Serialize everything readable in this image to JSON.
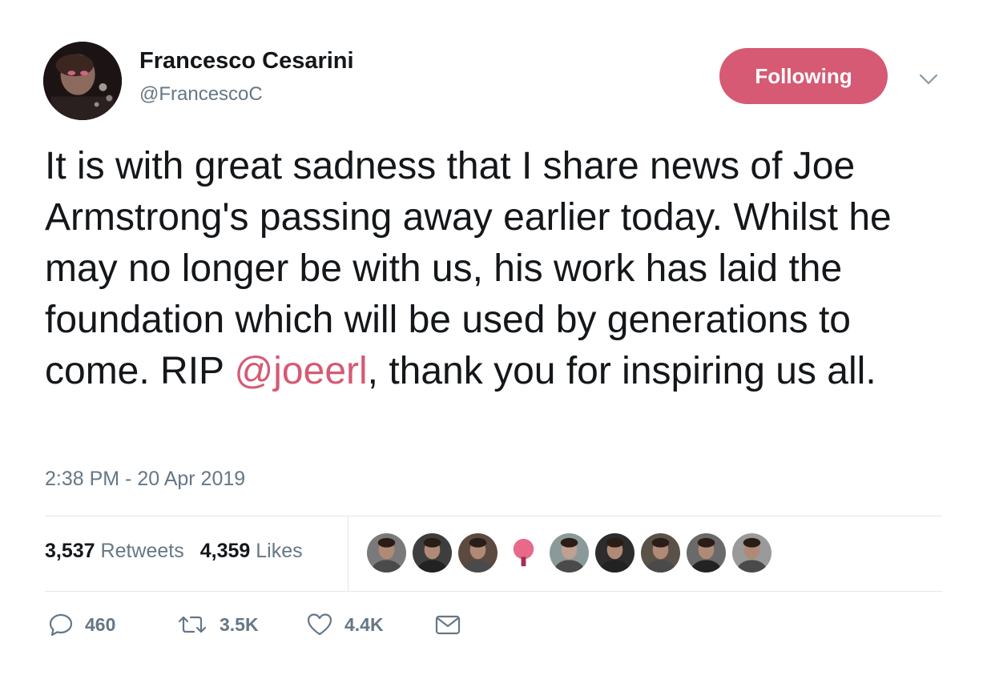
{
  "author": {
    "display_name": "Francesco Cesarini",
    "handle": "@FrancescoC",
    "avatar_icon": "user-photo"
  },
  "follow_button": {
    "label": "Following",
    "color": "#d65a74"
  },
  "caret_icon": "chevron-down-icon",
  "tweet": {
    "text_before": "It is with great sadness that I share news of Joe Armstrong's passing away earlier today. Whilst he may no longer be with us, his work has laid the foundation which will be used by generations to come. RIP ",
    "mention": "@joeerl",
    "text_after": ", thank you for inspiring us all.",
    "timestamp": "2:38 PM - 20 Apr 2019"
  },
  "stats": {
    "retweets_count": "3,537",
    "retweets_label": "Retweets",
    "likes_count": "4,359",
    "likes_label": "Likes"
  },
  "likers": [
    {
      "name": "liker-avatar-1",
      "bg": "#7a7a7a"
    },
    {
      "name": "liker-avatar-2",
      "bg": "#3e3e3e"
    },
    {
      "name": "liker-avatar-3",
      "bg": "#5c4a40"
    },
    {
      "name": "liker-avatar-4",
      "bg": "#ffffff"
    },
    {
      "name": "liker-avatar-5",
      "bg": "#8a9a9a"
    },
    {
      "name": "liker-avatar-6",
      "bg": "#2c2c2c"
    },
    {
      "name": "liker-avatar-7",
      "bg": "#5a5148"
    },
    {
      "name": "liker-avatar-8",
      "bg": "#6a6a6a"
    },
    {
      "name": "liker-avatar-9",
      "bg": "#9a9a9a"
    }
  ],
  "actions": {
    "reply_count": "460",
    "retweet_count": "3.5K",
    "like_count": "4.4K"
  },
  "accent_color": "#d65a74",
  "muted_color": "#657786"
}
